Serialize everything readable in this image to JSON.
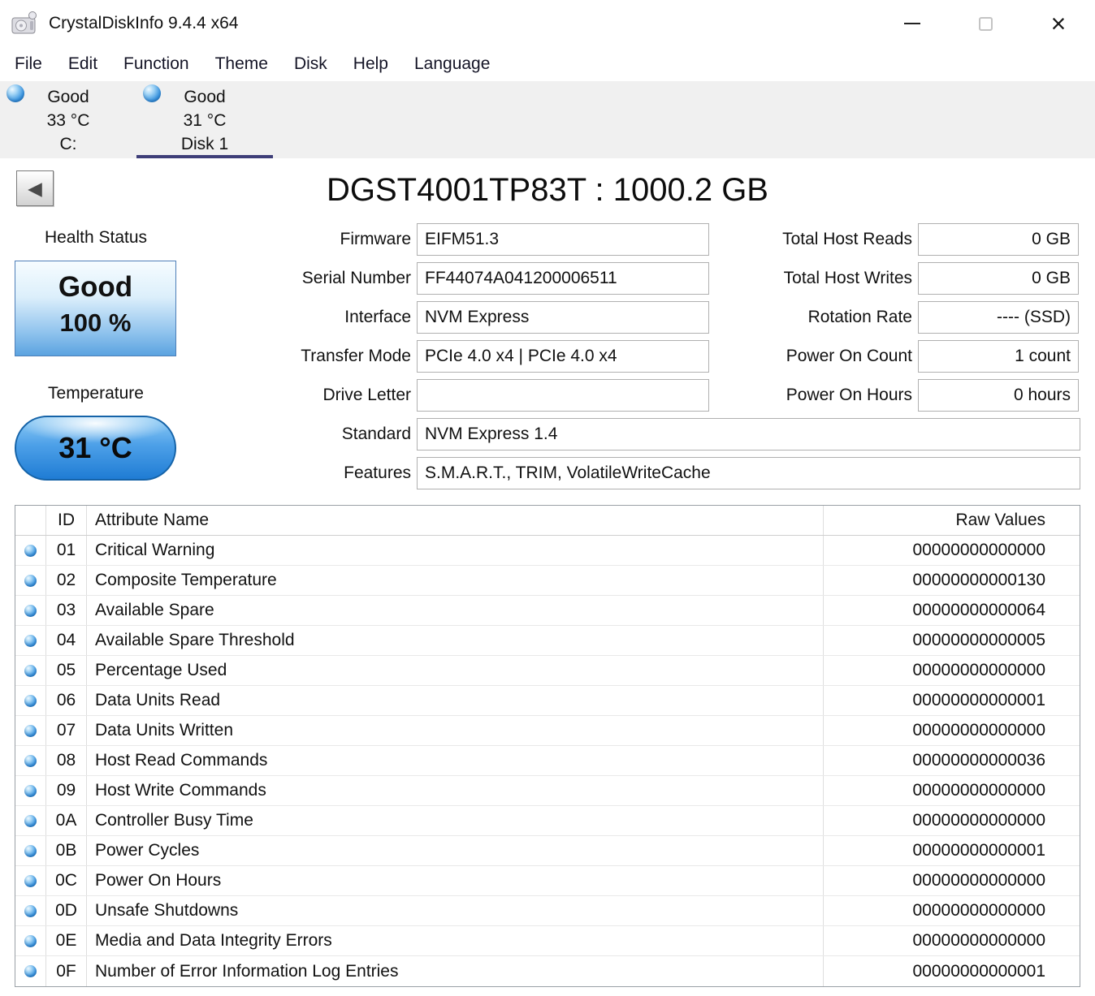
{
  "colors": {
    "good_status_blue": "#2e8de0",
    "selected_tab_underline": "#3e3e78",
    "health_box_blue": "#5ba3e0",
    "temperature_pill_blue": "#1f7cd4"
  },
  "window": {
    "title": "CrystalDiskInfo 9.4.4 x64",
    "controls": {
      "close": "×"
    }
  },
  "menu": {
    "items": [
      "File",
      "Edit",
      "Function",
      "Theme",
      "Disk",
      "Help",
      "Language"
    ]
  },
  "disk_tabs": [
    {
      "status": "Good",
      "temperature": "33 °C",
      "name": "C:"
    },
    {
      "status": "Good",
      "temperature": "31 °C",
      "name": "Disk 1"
    }
  ],
  "drive": {
    "back_glyph": "◀",
    "title": "DGST4001TP83T : 1000.2 GB",
    "health": {
      "label": "Health Status",
      "status": "Good",
      "percent": "100 %"
    },
    "temperature": {
      "label": "Temperature",
      "value": "31 °C"
    }
  },
  "info_fields": {
    "left": [
      {
        "label": "Firmware",
        "value": "EIFM51.3"
      },
      {
        "label": "Serial Number",
        "value": "FF44074A041200006511"
      },
      {
        "label": "Interface",
        "value": "NVM Express"
      },
      {
        "label": "Transfer Mode",
        "value": "PCIe 4.0 x4 | PCIe 4.0 x4"
      },
      {
        "label": "Drive Letter",
        "value": ""
      }
    ],
    "wide": [
      {
        "label": "Standard",
        "value": "NVM Express 1.4"
      },
      {
        "label": "Features",
        "value": "S.M.A.R.T., TRIM, VolatileWriteCache"
      }
    ],
    "right": [
      {
        "label": "Total Host Reads",
        "value": "0 GB"
      },
      {
        "label": "Total Host Writes",
        "value": "0 GB"
      },
      {
        "label": "Rotation Rate",
        "value": "---- (SSD)"
      },
      {
        "label": "Power On Count",
        "value": "1 count"
      },
      {
        "label": "Power On Hours",
        "value": "0 hours"
      }
    ]
  },
  "smart_table": {
    "headers": {
      "id": "ID",
      "name": "Attribute Name",
      "raw": "Raw Values"
    },
    "rows": [
      {
        "id": "01",
        "name": "Critical Warning",
        "raw": "00000000000000"
      },
      {
        "id": "02",
        "name": "Composite Temperature",
        "raw": "00000000000130"
      },
      {
        "id": "03",
        "name": "Available Spare",
        "raw": "00000000000064"
      },
      {
        "id": "04",
        "name": "Available Spare Threshold",
        "raw": "00000000000005"
      },
      {
        "id": "05",
        "name": "Percentage Used",
        "raw": "00000000000000"
      },
      {
        "id": "06",
        "name": "Data Units Read",
        "raw": "00000000000001"
      },
      {
        "id": "07",
        "name": "Data Units Written",
        "raw": "00000000000000"
      },
      {
        "id": "08",
        "name": "Host Read Commands",
        "raw": "00000000000036"
      },
      {
        "id": "09",
        "name": "Host Write Commands",
        "raw": "00000000000000"
      },
      {
        "id": "0A",
        "name": "Controller Busy Time",
        "raw": "00000000000000"
      },
      {
        "id": "0B",
        "name": "Power Cycles",
        "raw": "00000000000001"
      },
      {
        "id": "0C",
        "name": "Power On Hours",
        "raw": "00000000000000"
      },
      {
        "id": "0D",
        "name": "Unsafe Shutdowns",
        "raw": "00000000000000"
      },
      {
        "id": "0E",
        "name": "Media and Data Integrity Errors",
        "raw": "00000000000000"
      },
      {
        "id": "0F",
        "name": "Number of Error Information Log Entries",
        "raw": "00000000000001"
      }
    ]
  }
}
